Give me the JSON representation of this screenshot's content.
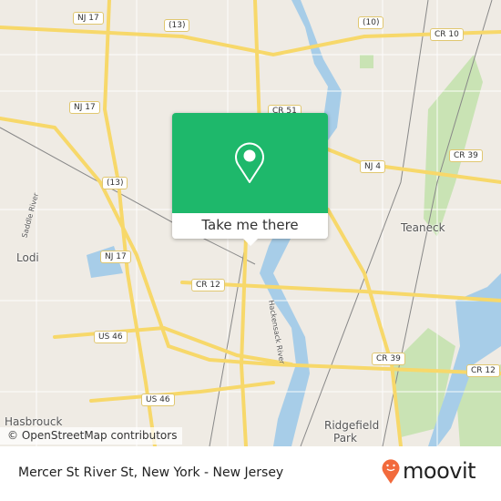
{
  "map": {
    "colors": {
      "land": "#efebe4",
      "road": "#f7d86a",
      "water": "#a7cde8",
      "park": "#c9e3b4",
      "accent": "#1eb86b",
      "brand": "#f26a3c"
    },
    "road_shields": [
      {
        "label": "NJ 17"
      },
      {
        "label": "(13)"
      },
      {
        "label": "(10)"
      },
      {
        "label": "CR 10"
      },
      {
        "label": "NJ 17"
      },
      {
        "label": "CR 51"
      },
      {
        "label": "NJ 4"
      },
      {
        "label": "CR 39"
      },
      {
        "label": "(13)"
      },
      {
        "label": "NJ 17"
      },
      {
        "label": "CR 12"
      },
      {
        "label": "US 46"
      },
      {
        "label": "CR 39"
      },
      {
        "label": "CR 12"
      },
      {
        "label": "US 46"
      }
    ],
    "places": {
      "teaneck": "Teaneck",
      "lodi": "Lodi",
      "hasbrouck": "Hasbrouck",
      "ridgefield": "Ridgefield",
      "park": "Park"
    },
    "rivers": {
      "saddle": "Saddle River",
      "hackensack": "Hackensack River"
    },
    "attribution": "© OpenStreetMap contributors"
  },
  "popup": {
    "icon": "location-pin-icon",
    "button_label": "Take me there"
  },
  "footer": {
    "title": "Mercer St River St, New York - New Jersey",
    "logo": "moovit"
  }
}
